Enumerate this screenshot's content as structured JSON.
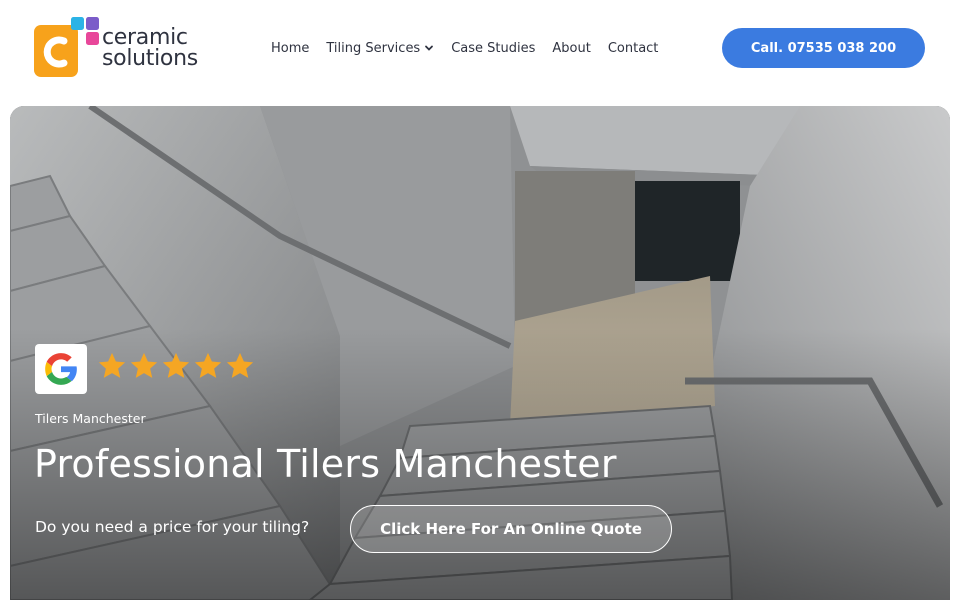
{
  "logo": {
    "line1": "ceramic",
    "line2": "solutions",
    "colors": {
      "orange": "#f7a21b",
      "blue": "#2bb3e6",
      "pink": "#e8479a",
      "purple": "#7b5cc9"
    }
  },
  "nav": {
    "items": [
      {
        "label": "Home"
      },
      {
        "label": "Tiling Services",
        "has_dropdown": true
      },
      {
        "label": "Case Studies"
      },
      {
        "label": "About"
      },
      {
        "label": "Contact"
      }
    ]
  },
  "call_button": {
    "label": "Call. 07535 038 200",
    "color": "#3b7be0"
  },
  "hero": {
    "rating_stars": 5,
    "star_color": "#f5a623",
    "kicker": "Tilers Manchester",
    "title": "Professional Tilers Manchester",
    "question": "Do you need a price for your tiling?",
    "quote_button": "Click Here For An Online Quote"
  }
}
